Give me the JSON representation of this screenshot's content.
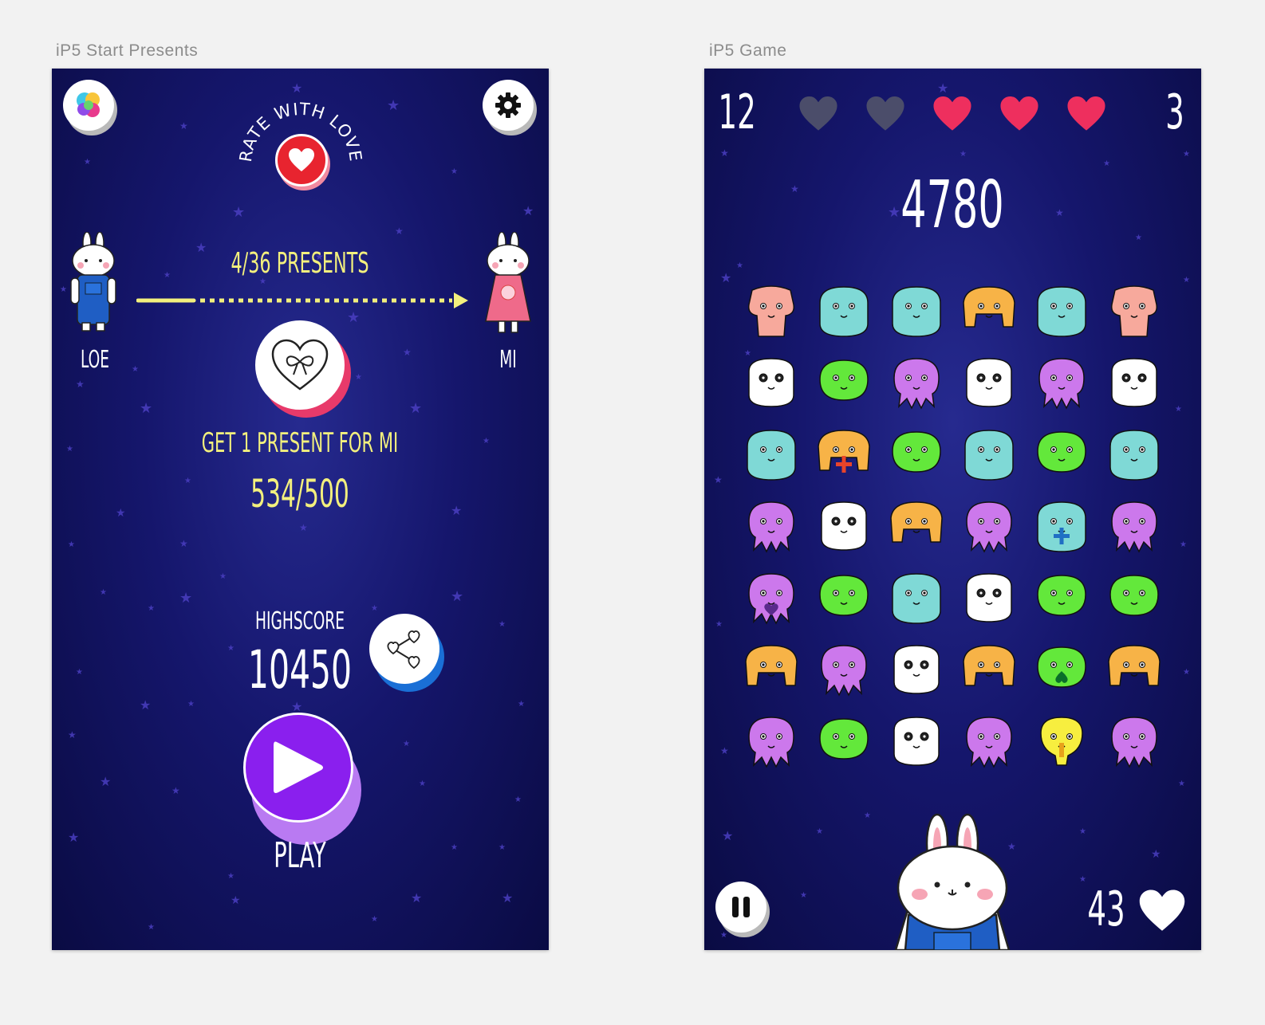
{
  "artboards": {
    "start_label": "iP5 Start Presents",
    "game_label": "iP5 Game"
  },
  "start": {
    "rate_text": "RATE WITH LOVE",
    "left_character": "LOE",
    "right_character": "MI",
    "presents_progress": "4/36 PRESENTS",
    "present_goal": "GET 1 PRESENT FOR MI",
    "present_points": "534/500",
    "highscore_label": "HIGHSCORE",
    "highscore_value": "10450",
    "play_label": "PLAY",
    "icons": [
      "game-center-icon",
      "gear-icon",
      "heart-icon",
      "heart-bow-icon",
      "share-hearts-icon",
      "play-icon"
    ],
    "colors": {
      "gold": "#f3f07d",
      "rate_red": "#e8242f",
      "gift_pink": "#e83a6a",
      "share_blue": "#1a6fd6",
      "play_purple": "#8a1fee"
    }
  },
  "game": {
    "level": "12",
    "lives_total": 5,
    "lives_filled": 3,
    "lives_count": "3",
    "score": "4780",
    "hearts_collected": "43",
    "icons": [
      "pause-icon",
      "heart-icon",
      "bunny-icon"
    ],
    "board": [
      [
        "pink-bear",
        "teal-blob",
        "teal-blob",
        "orange-crab",
        "teal-blob",
        "pink-bear"
      ],
      [
        "panda",
        "green-sprout",
        "purple-octo",
        "panda",
        "purple-octo",
        "panda"
      ],
      [
        "teal-blob",
        "orange-plus",
        "green-sprout",
        "teal-blob",
        "green-sprout",
        "teal-blob"
      ],
      [
        "purple-octo",
        "panda",
        "orange-crab",
        "purple-octo",
        "teal-plus",
        "purple-octo"
      ],
      [
        "purple-heart",
        "green-sprout",
        "teal-blob",
        "panda",
        "green-sprout",
        "green-sprout"
      ],
      [
        "orange-crab",
        "purple-octo",
        "panda",
        "orange-crab",
        "green-spade",
        "orange-crab"
      ],
      [
        "purple-octo",
        "green-sprout",
        "panda",
        "purple-octo",
        "yellow-bulb",
        "purple-octo"
      ]
    ],
    "colors": {
      "heart_on": "#ee2f5e",
      "heart_off": "#4b4d6a"
    }
  }
}
